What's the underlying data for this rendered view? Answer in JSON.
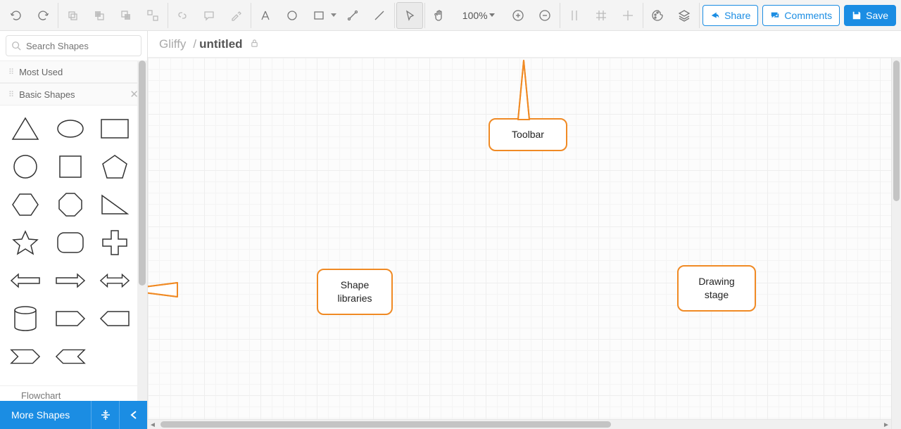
{
  "toolbar": {
    "zoom": "100%",
    "share": "Share",
    "comments": "Comments",
    "save": "Save"
  },
  "sidebar": {
    "search_placeholder": "Search Shapes",
    "sections": {
      "most_used": "Most Used",
      "basic_shapes": "Basic Shapes",
      "flowchart": "Flowchart"
    },
    "more_shapes": "More Shapes"
  },
  "document": {
    "brand": "Gliffy",
    "name": "untitled"
  },
  "callouts": {
    "toolbar": "Toolbar",
    "shapes": "Shape libraries",
    "stage": "Drawing stage"
  }
}
